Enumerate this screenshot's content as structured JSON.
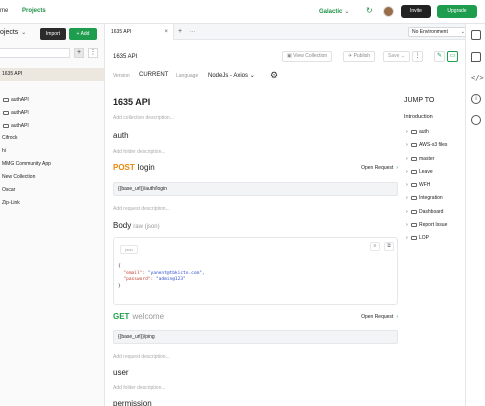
{
  "topbar": {
    "home": "me",
    "projects": "Projects",
    "workspace": "Galactic",
    "invite": "Invite",
    "upgrade": "Upgrade"
  },
  "sidebar": {
    "title": "ojects",
    "import": "Import",
    "add": "+ Add",
    "search_placeholder": "",
    "items": [
      {
        "label": "1635 API",
        "type": "collection",
        "active": true
      },
      {
        "label": "authAPI",
        "type": "folder"
      },
      {
        "label": "authAPI",
        "type": "folder"
      },
      {
        "label": "authAPI",
        "type": "folder"
      },
      {
        "label": "Cifrock",
        "type": "collection"
      },
      {
        "label": "hi",
        "type": "collection"
      },
      {
        "label": "MMG Community App",
        "type": "collection"
      },
      {
        "label": "New Collection",
        "type": "collection"
      },
      {
        "label": "Oscar",
        "type": "collection"
      },
      {
        "label": "Zip-Link",
        "type": "collection"
      }
    ]
  },
  "tabs": {
    "active": "1635 API",
    "environment": "No Environment"
  },
  "toolbar": {
    "title": "1635 API",
    "view_collection": "View Collection",
    "publish": "Publish",
    "save": "Save",
    "version_label": "Version",
    "version_value": "CURRENT",
    "language_label": "Language",
    "language_value": "NodeJs - Axios"
  },
  "doc": {
    "title": "1635 API",
    "collection_desc": "Add collection description...",
    "auth_folder": "auth",
    "folder_desc": "Add folder description...",
    "login": {
      "method": "POST",
      "name": "login",
      "open": "Open Request",
      "url": "{{base_url}}/auth/login",
      "desc": "Add request description...",
      "body_label": "Body",
      "body_type": "raw (json)",
      "json_tag": "json",
      "code_open": "{",
      "email_key": "\"email\":",
      "email_val": "\"yanent@tbkicto.com\",",
      "password_key": "\"password\":",
      "password_val": "\"admin@123\"",
      "code_close": "}"
    },
    "welcome": {
      "method": "GET",
      "name": "welcome",
      "open": "Open Request",
      "url": "{{base_url}}/ping",
      "desc": "Add request description..."
    },
    "user_folder": "user",
    "user_desc": "Add folder description...",
    "permission": "permission"
  },
  "jump": {
    "title": "JUMP TO",
    "intro": "Introduction",
    "items": [
      "auth",
      "AWS-s3 files",
      "master",
      "Leave",
      "WFH",
      "Integration",
      "Dashboard",
      "Report Issue",
      "LOP"
    ]
  }
}
